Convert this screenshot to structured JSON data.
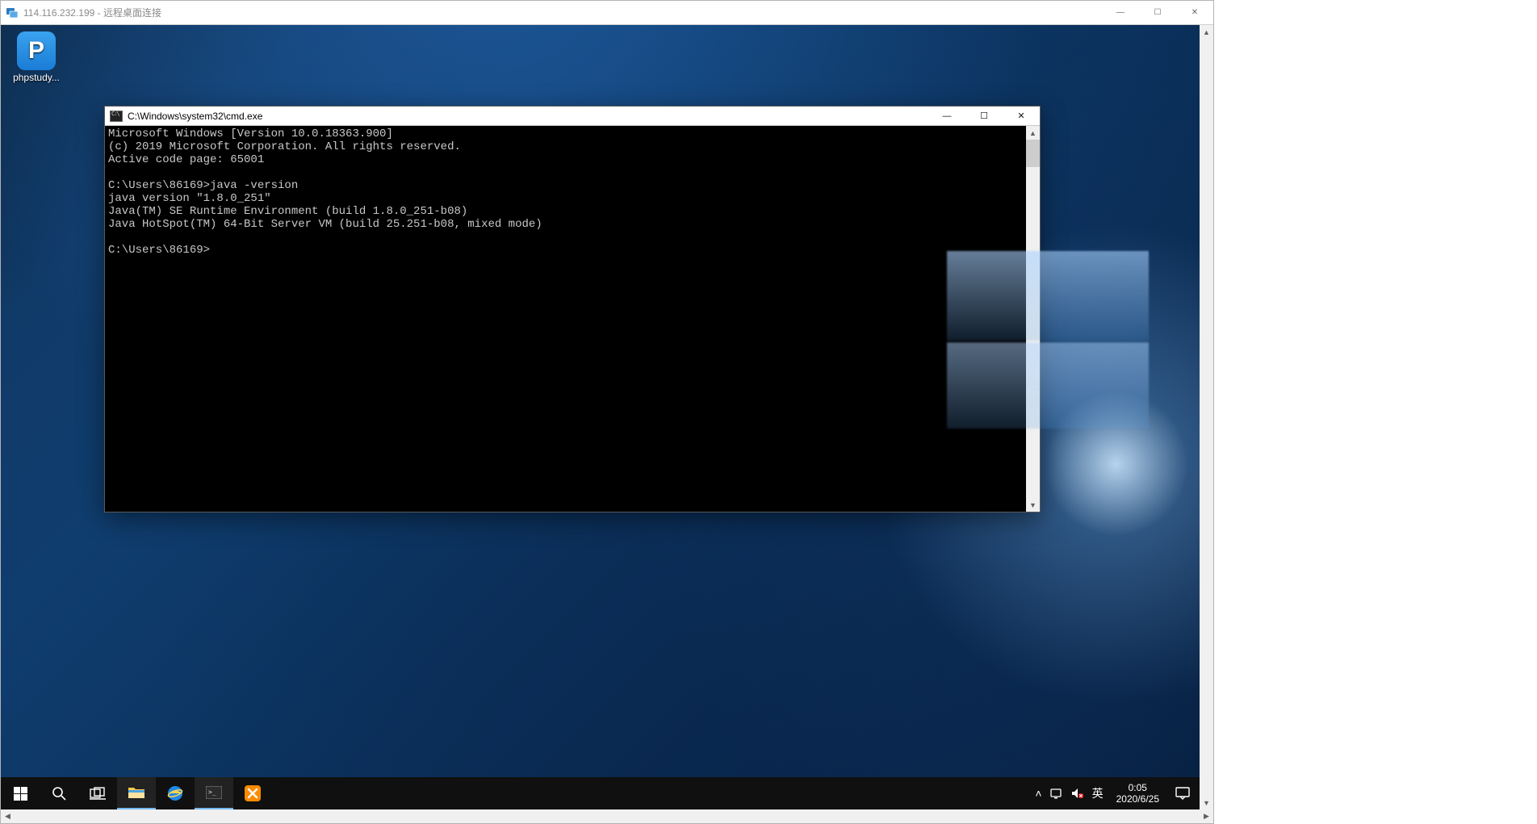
{
  "rdc": {
    "title": "114.116.232.199 - 远程桌面连接"
  },
  "desktop_icons": [
    {
      "letter": "P",
      "label": "phpstudy..."
    }
  ],
  "cmd": {
    "title": "C:\\Windows\\system32\\cmd.exe",
    "lines": [
      "Microsoft Windows [Version 10.0.18363.900]",
      "(c) 2019 Microsoft Corporation. All rights reserved.",
      "Active code page: 65001",
      "",
      "C:\\Users\\86169>java -version",
      "java version \"1.8.0_251\"",
      "Java(TM) SE Runtime Environment (build 1.8.0_251-b08)",
      "Java HotSpot(TM) 64-Bit Server VM (build 25.251-b08, mixed mode)",
      "",
      "C:\\Users\\86169>"
    ]
  },
  "taskbar": {
    "ime": "英",
    "time": "0:05",
    "date": "2020/6/25"
  },
  "glyphs": {
    "minimize": "—",
    "maximize": "☐",
    "close": "✕",
    "up": "▲",
    "down": "▼",
    "left": "◀",
    "right": "▶",
    "chevron_up": "˄"
  }
}
